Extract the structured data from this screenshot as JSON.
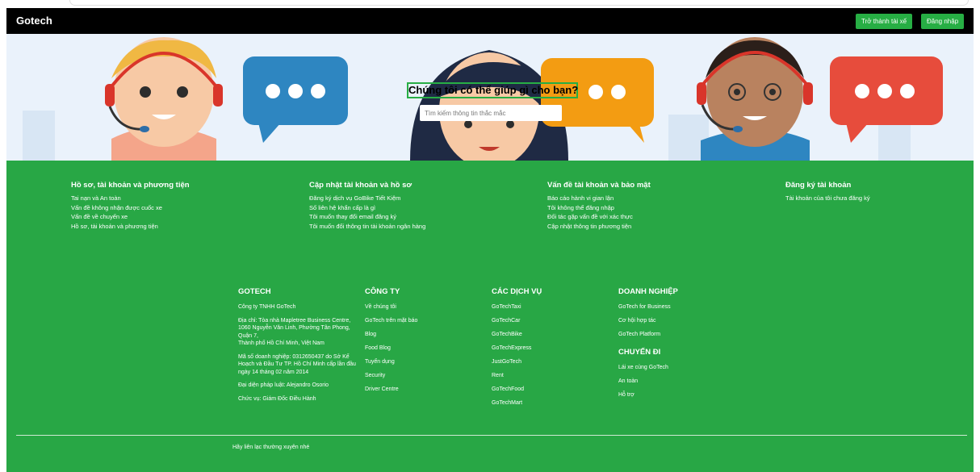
{
  "navbar": {
    "brand": "Gotech",
    "driver_button": "Trở thành tài xế",
    "login_button": "Đăng nhập"
  },
  "hero": {
    "title": "Chúng tôi có thể giúp gì cho bạn?",
    "search_placeholder": "Tìm kiếm thông tin thắc mắc"
  },
  "topics": [
    {
      "title": "Hồ sơ, tài khoản và phương tiện",
      "links": [
        "Tai nạn và An toàn",
        "Vấn đề không nhận được cuốc xe",
        "Vấn đề về chuyến xe",
        "Hồ sơ, tài khoản và phương tiện"
      ]
    },
    {
      "title": "Cập nhật tài khoản và hồ sơ",
      "links": [
        "Đăng ký dịch vụ GoBike Tiết Kiệm",
        "Số liên hệ khẩn cấp là gì",
        "Tôi muốn thay đổi email đăng ký",
        "Tôi muốn đổi thông tin tài khoản ngân hàng"
      ]
    },
    {
      "title": "Vấn đề tài khoản và bảo mật",
      "links": [
        "Báo cáo hành vi gian lận",
        "Tôi không thể đăng nhập",
        "Đối tác gặp vấn đề với xác thực",
        "Cập nhật thông tin phương tiện"
      ]
    },
    {
      "title": "Đăng ký tài khoản",
      "links": [
        "Tài khoản của tôi chưa đăng ký"
      ]
    }
  ],
  "footer": {
    "company_col": {
      "title": "GOTECH",
      "paragraphs": [
        "Công ty TNHH GoTech",
        "Địa chỉ: Tòa nhà Mapletree Business Centre, 1060 Nguyễn Văn Linh, Phường Tân Phong, Quận 7,",
        "Thành phố Hồ Chí Minh, Việt Nam",
        "Mã số doanh nghiệp: 0312650437 do Sở Kế Hoạch và Đầu Tư TP. Hồ Chí Minh cấp lần đầu ngày 14 tháng 02 năm 2014",
        "Đại diện pháp luật: Alejandro Osorio",
        "Chức vụ: Giám Đốc Điều Hành"
      ]
    },
    "cong_ty": {
      "title": "CÔNG TY",
      "links": [
        "Về chúng tôi",
        "GoTech trên mặt báo",
        "Blog",
        "Food Blog",
        "Tuyển dụng",
        "Security",
        "Driver Centre"
      ]
    },
    "services": {
      "title": "CÁC DỊCH VỤ",
      "links": [
        "GoTechTaxi",
        "GoTechCar",
        "GoTechBike",
        "GoTechExpress",
        "JustGoTech",
        "Rent",
        "GoTechFood",
        "GoTechMart"
      ]
    },
    "business": {
      "title": "DOANH NGHIỆP",
      "links": [
        "GoTech for Business",
        "Cơ hội hợp tác",
        "GoTech Platform"
      ]
    },
    "trip": {
      "title": "CHUYẾN ĐI",
      "links": [
        "Lái xe cùng GoTech",
        "An toàn",
        "Hỗ trợ"
      ]
    },
    "note": "Hãy liên lạc thường xuyên nhé"
  },
  "colors": {
    "green": "#28a745",
    "navbar": "#000000",
    "bubble_blue": "#2e86c1",
    "bubble_orange": "#f39c12",
    "bubble_red": "#e74c3c"
  },
  "icons": [
    "support-agent-illustration",
    "chat-bubble-icon"
  ]
}
